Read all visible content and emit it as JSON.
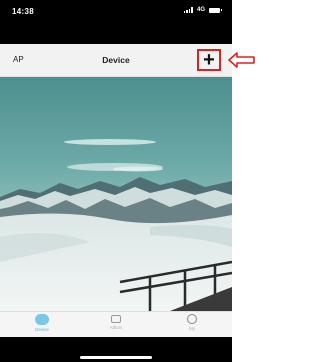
{
  "status_bar": {
    "time": "14:38",
    "network": "4G"
  },
  "nav": {
    "left_label": "AP",
    "title": "Device",
    "add_label": "+"
  },
  "tabs": [
    {
      "label": "Device",
      "icon": "camera-icon",
      "active": true
    },
    {
      "label": "Album",
      "icon": "album-icon",
      "active": false
    },
    {
      "label": "My",
      "icon": "user-icon",
      "active": false
    }
  ],
  "colors": {
    "highlight": "#e02020",
    "active_tab": "#55b0d8",
    "nav_background": "#f2f2f2"
  }
}
